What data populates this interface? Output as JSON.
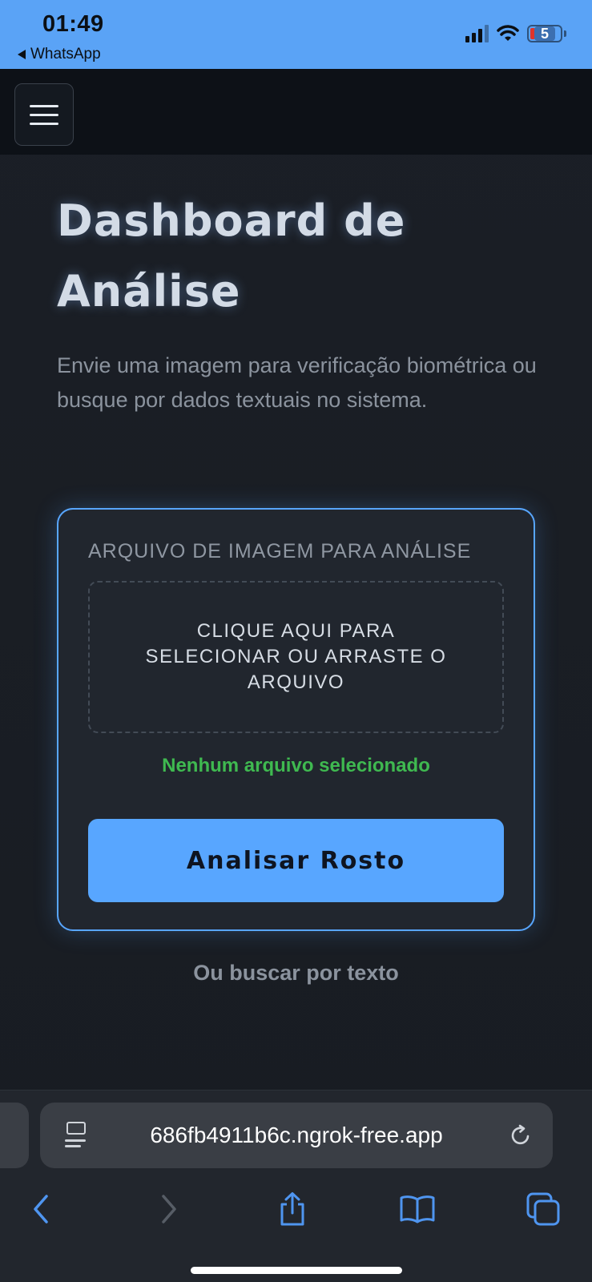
{
  "status_bar": {
    "time": "01:49",
    "back_app": "WhatsApp",
    "battery_level": "5",
    "icons": [
      "cellular-signal-icon",
      "wifi-icon",
      "battery-icon"
    ]
  },
  "header": {
    "menu_icon": "hamburger-menu-icon"
  },
  "main": {
    "title": "Dashboard de Análise",
    "subtitle": "Envie uma imagem para verificação biométrica ou busque por dados textuais no sistema.",
    "upload_card": {
      "label": "ARQUIVO DE IMAGEM PARA ANÁLISE",
      "dropzone_text": "CLIQUE AQUI PARA SELECIONAR OU ARRASTE O ARQUIVO",
      "file_status": "Nenhum arquivo selecionado",
      "button_label": "Analisar Rosto"
    },
    "text_search_link": "Ou buscar por texto"
  },
  "browser": {
    "url": "686fb4911b6c.ngrok-free.app",
    "toolbar_icons": [
      "back-icon",
      "forward-icon",
      "share-icon",
      "bookmarks-icon",
      "tabs-icon"
    ]
  },
  "colors": {
    "status_bar": "#5aa3f6",
    "accent": "#58a6ff",
    "success": "#3fb950",
    "background": "#1b1f26"
  }
}
